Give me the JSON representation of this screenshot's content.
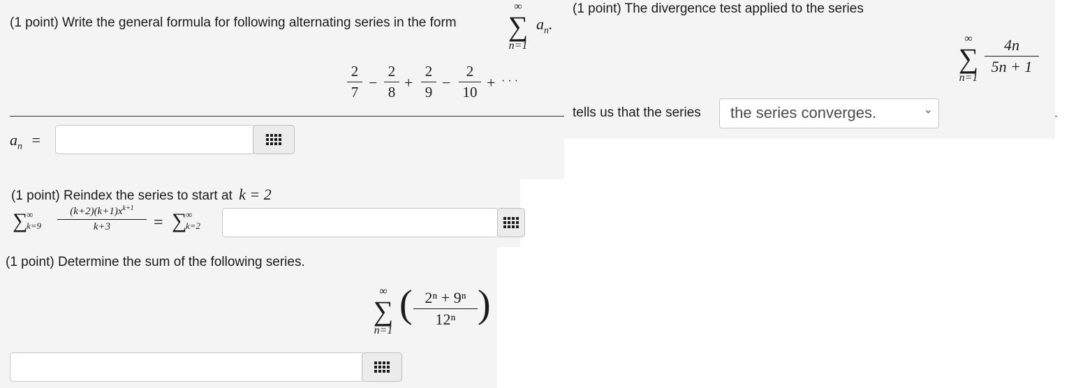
{
  "problem1": {
    "prompt": "(1 point) Write the general formula for following alternating series in the form",
    "series": [
      {
        "num": "2",
        "den": "7"
      },
      {
        "num": "2",
        "den": "8"
      },
      {
        "num": "2",
        "den": "9"
      },
      {
        "num": "2",
        "den": "10"
      }
    ],
    "ops": [
      "−",
      "+",
      "−",
      "+"
    ],
    "ellipsis": "· · ·",
    "answer_label": "a",
    "answer_sub": "n",
    "answer_eq": "=",
    "answer_value": ""
  },
  "problem2": {
    "prompt": "(1 point) The divergence test applied to the series",
    "num": "4n",
    "den": "5n + 1",
    "follow": "tells us that the series",
    "select_value": "the series converges.",
    "select_caret": "⌄"
  },
  "problem3": {
    "prompt_prefix": "(1 point) Reindex the series to start at",
    "start": "k = 2",
    "lhs_num": "(k+2)(k+1)x",
    "lhs_exp": "k+1",
    "lhs_den": "k+3",
    "lhs_lower": "k=9",
    "rhs_lower": "k=2",
    "eq": "=",
    "answer_value": ""
  },
  "problem4": {
    "prompt": "(1 point) Determine the sum of the following series.",
    "num": "2ⁿ + 9ⁿ",
    "den": "12ⁿ",
    "answer_value": ""
  },
  "sigma": {
    "symbol": "∑",
    "upper": "∞",
    "lower": "n=1"
  },
  "icons": {
    "palette": "grid-icon",
    "dropdown": "chevron-down-icon"
  }
}
